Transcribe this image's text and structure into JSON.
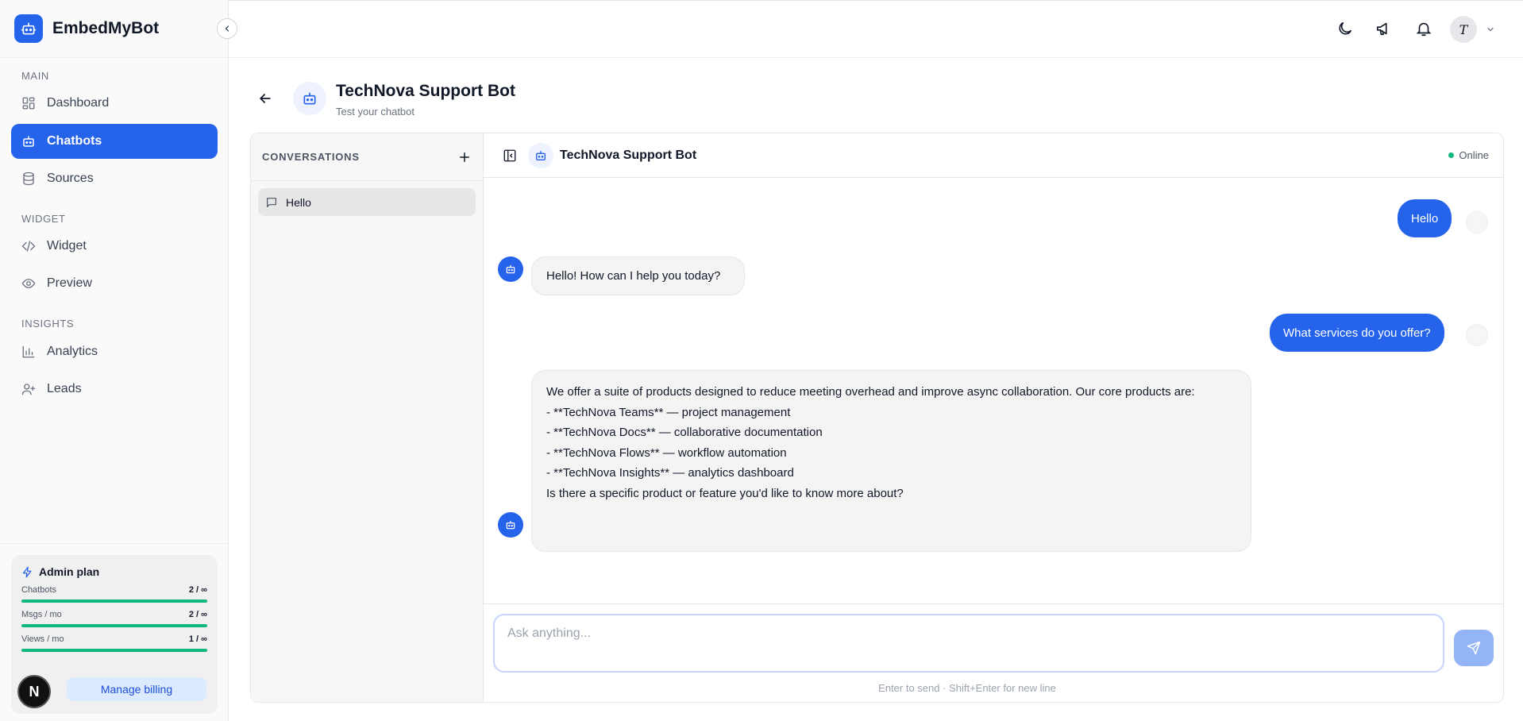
{
  "brand": {
    "name": "EmbedMyBot"
  },
  "sidebar": {
    "sections": [
      {
        "title": "MAIN"
      },
      {
        "title": "WIDGET"
      },
      {
        "title": "INSIGHTS"
      }
    ],
    "items": [
      {
        "label": "Dashboard",
        "icon": "grid-icon"
      },
      {
        "label": "Chatbots",
        "icon": "bot-icon",
        "active": true
      },
      {
        "label": "Sources",
        "icon": "database-icon"
      },
      {
        "label": "Widget",
        "icon": "code-icon"
      },
      {
        "label": "Preview",
        "icon": "eye-icon"
      },
      {
        "label": "Analytics",
        "icon": "bar-chart-icon"
      },
      {
        "label": "Leads",
        "icon": "user-plus-icon"
      }
    ],
    "plan": {
      "title": "Admin plan",
      "rows": [
        {
          "label": "Chatbots",
          "value": "2 / ∞",
          "progress": 1.0
        },
        {
          "label": "Msgs / mo",
          "value": "2 / ∞",
          "progress": 1.0
        },
        {
          "label": "Views / mo",
          "value": "1 / ∞",
          "progress": 1.0
        }
      ],
      "billing_label": "Manage billing"
    },
    "badge_letter": "N"
  },
  "topbar": {
    "icons": [
      "moon-icon",
      "megaphone-icon",
      "bell-icon"
    ],
    "avatar_letter": "T"
  },
  "page": {
    "title": "TechNova Support Bot",
    "subtitle": "Test your chatbot"
  },
  "conversations": {
    "heading": "CONVERSATIONS",
    "items": [
      {
        "label": "Hello"
      }
    ]
  },
  "chat": {
    "bot_name": "TechNova Support Bot",
    "status": "Online",
    "messages": [
      {
        "role": "user",
        "text": "Hello"
      },
      {
        "role": "bot",
        "text": "Hello! How can I help you today?"
      },
      {
        "role": "user",
        "text": "What services do you offer?"
      },
      {
        "role": "bot",
        "lines": [
          "We offer a suite of products designed to reduce meeting overhead and improve async collaboration. Our core products are:",
          "",
          "- **TechNova Teams** — project management",
          "- **TechNova Docs** — collaborative documentation",
          "- **TechNova Flows** — workflow automation",
          "- **TechNova Insights** — analytics dashboard",
          "",
          "Is there a specific product or feature you'd like to know more about?"
        ]
      }
    ],
    "input_placeholder": "Ask anything...",
    "input_value": "",
    "hint": "Enter to send · Shift+Enter for new line"
  },
  "colors": {
    "accent": "#2563eb",
    "online": "#10b981",
    "progress": "#10b981"
  }
}
